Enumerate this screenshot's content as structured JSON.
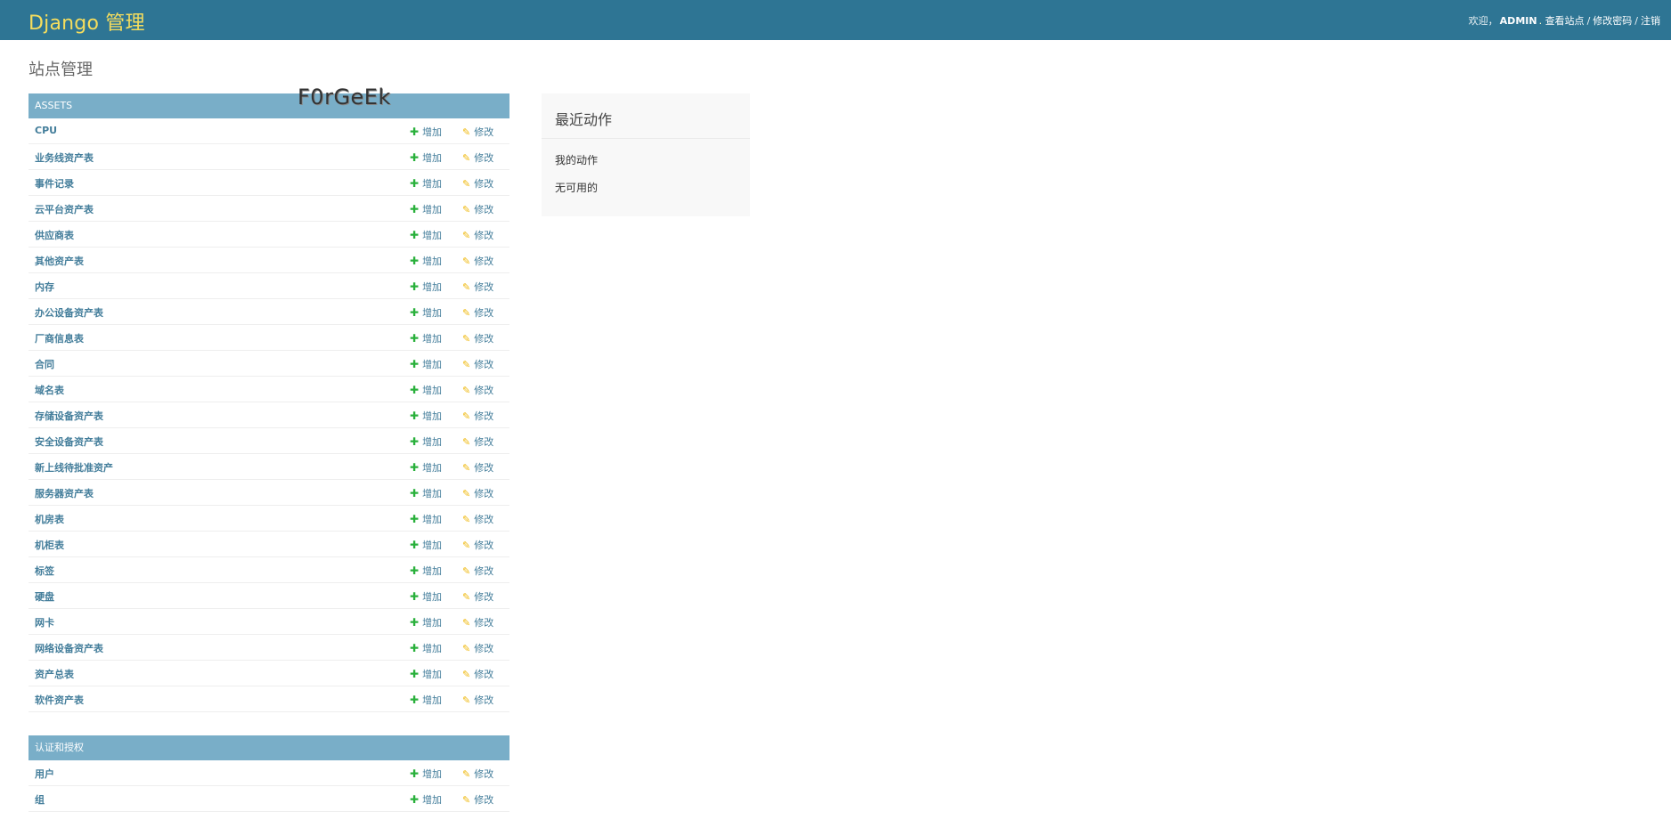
{
  "header": {
    "brand": "Django 管理",
    "welcome": "欢迎，",
    "username": "ADMIN",
    "view_site": "查看站点",
    "change_password": "修改密码",
    "logout": "注销",
    "sep": "/"
  },
  "page_title": "站点管理",
  "watermark": "F0rGeEk",
  "add_label": "增加",
  "change_label": "修改",
  "modules": [
    {
      "caption": "ASSETS",
      "models": [
        "CPU",
        "业务线资产表",
        "事件记录",
        "云平台资产表",
        "供应商表",
        "其他资产表",
        "内存",
        "办公设备资产表",
        "厂商信息表",
        "合同",
        "域名表",
        "存储设备资产表",
        "安全设备资产表",
        "新上线待批准资产",
        "服务器资产表",
        "机房表",
        "机柜表",
        "标签",
        "硬盘",
        "网卡",
        "网络设备资产表",
        "资产总表",
        "软件资产表"
      ]
    },
    {
      "caption": "认证和授权",
      "models": [
        "用户",
        "组"
      ]
    }
  ],
  "recent_actions": {
    "title": "最近动作",
    "subtitle": "我的动作",
    "none": "无可用的"
  },
  "colors": {
    "header_bg": "#2e7594",
    "brand": "#f5dd5d",
    "caption_bg": "#79aec8",
    "link": "#447e9b",
    "add_icon": "#29b03b",
    "change_icon": "#efb80b"
  },
  "icons": {
    "add": "plus-icon",
    "change": "pencil-icon"
  }
}
